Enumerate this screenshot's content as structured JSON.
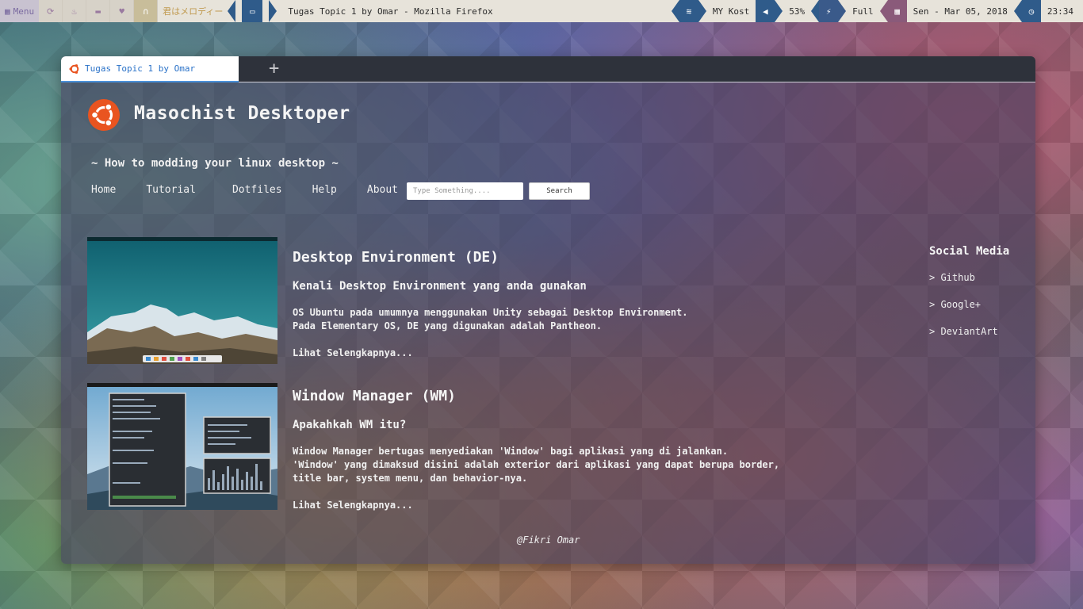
{
  "panel": {
    "menu_label": "Menu",
    "now_playing": "君はメロディー",
    "window_title": "Tugas Topic 1 by Omar - Mozilla Firefox",
    "wifi": "MY Kost",
    "volume": "53%",
    "battery": "Full",
    "date": "Sen - Mar 05, 2018",
    "time": "23:34",
    "workspace_icons": [
      "refresh-icon",
      "fire-icon",
      "folder-icon",
      "heartbeat-icon",
      "headphones-icon"
    ]
  },
  "browser": {
    "tab_title": "Tugas Topic 1 by Omar",
    "new_tab_glyph": "+"
  },
  "site": {
    "title": "Masochist Desktoper",
    "tagline": "~ How to modding your linux desktop ~",
    "nav": [
      "Home",
      "Tutorial",
      "Dotfiles",
      "Help",
      "About"
    ],
    "search_placeholder": "Type Something....",
    "search_button": "Search",
    "posts": [
      {
        "title": "Desktop Environment (DE)",
        "subtitle": "Kenali Desktop Environment yang anda gunakan",
        "body": [
          "OS Ubuntu pada umumnya menggunakan Unity sebagai Desktop Environment.",
          "Pada Elementary OS, DE yang digunakan adalah Pantheon."
        ],
        "more": "Lihat Selengkapnya..."
      },
      {
        "title": "Window Manager (WM)",
        "subtitle": "Apakahkah WM itu?",
        "body": [
          "Window Manager bertugas menyediakan 'Window' bagi aplikasi yang di jalankan.",
          "'Window' yang dimaksud disini adalah exterior dari aplikasi yang dapat berupa border,",
          "title bar, system menu, dan behavior-nya."
        ],
        "more": "Lihat Selengkapnya..."
      }
    ],
    "social_title": "Social Media",
    "social_links": [
      "> Github",
      "> Google+",
      "> DeviantArt"
    ],
    "footer": "@Fikri Omar"
  }
}
